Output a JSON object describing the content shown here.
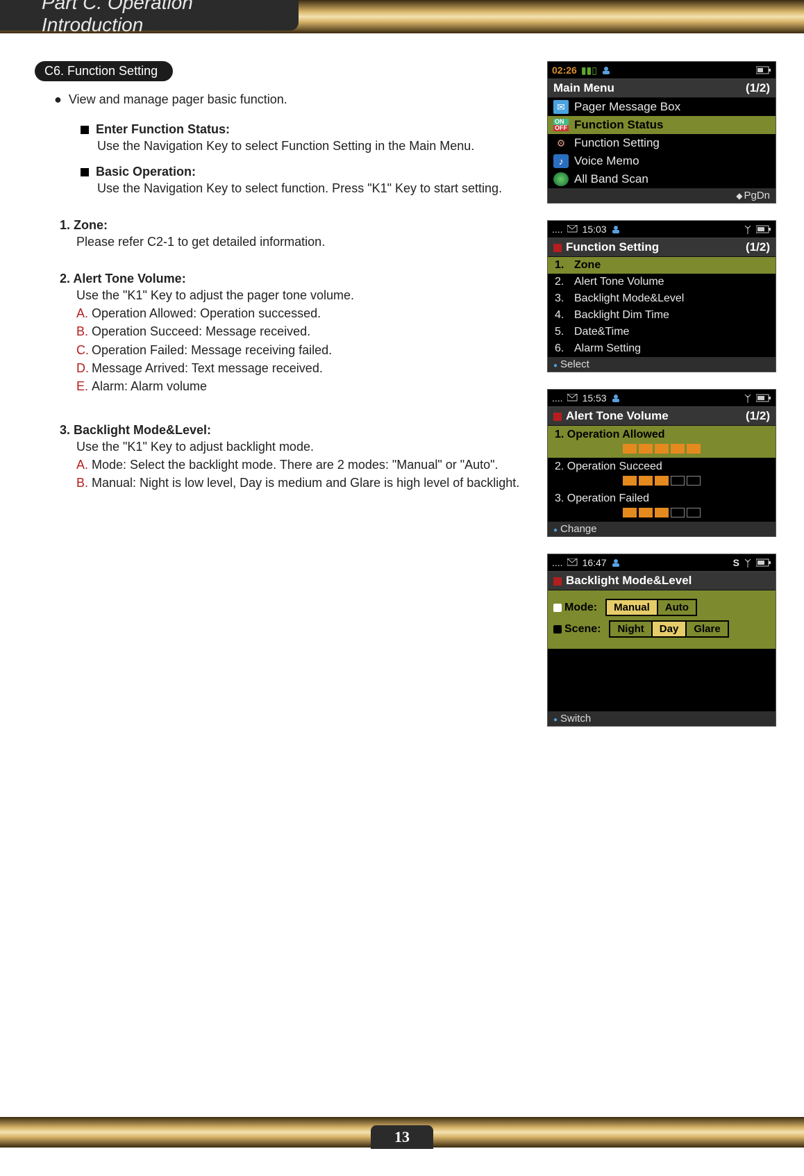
{
  "header": {
    "title": "Part C. Operation Introduction"
  },
  "section_tag": "C6. Function Setting",
  "intro_bullet": "View and manage pager basic function.",
  "squares": [
    {
      "label": "Enter Function Status:",
      "desc": "Use the Navigation Key to select Function Setting in the Main Menu."
    },
    {
      "label": "Basic Operation:",
      "desc": "Use the Navigation Key to select function. Press \"K1\" Key to start setting."
    }
  ],
  "items": {
    "item1": {
      "heading": "1. Zone:",
      "body": "Please refer C2-1 to get detailed information."
    },
    "item2": {
      "heading": "2. Alert Tone Volume:",
      "intro": "Use the \"K1\" Key to adjust the pager tone volume.",
      "subs": [
        {
          "l": "A.",
          "t": "Operation Allowed: Operation successed."
        },
        {
          "l": "B.",
          "t": "Operation Succeed: Message received."
        },
        {
          "l": "C.",
          "t": "Operation Failed: Message receiving failed."
        },
        {
          "l": "D.",
          "t": "Message Arrived: Text message received."
        },
        {
          "l": "E.",
          "t": "Alarm: Alarm volume"
        }
      ]
    },
    "item3": {
      "heading": "3. Backlight Mode&Level:",
      "intro": "Use the \"K1\" Key to adjust backlight mode.",
      "subs": [
        {
          "l": "A.",
          "t": "Mode: Select the backlight mode. There are 2 modes: \"Manual\" or \"Auto\"."
        },
        {
          "l": "B.",
          "t": "Manual: Night is low level, Day is medium and Glare is high level of backlight."
        }
      ]
    }
  },
  "page_number": "13",
  "screens": {
    "main_menu": {
      "time": "02:26",
      "title": "Main Menu",
      "page": "(1/2)",
      "rows": [
        {
          "text": "Pager Message Box"
        },
        {
          "text": "Function Status",
          "sel": true
        },
        {
          "text": "Function Setting"
        },
        {
          "text": "Voice Memo"
        },
        {
          "text": "All Band Scan"
        }
      ],
      "foot_right": "PgDn"
    },
    "function_setting": {
      "time": "15:03",
      "title": "Function Setting",
      "page": "(1/2)",
      "rows": [
        {
          "n": "1.",
          "t": "Zone",
          "sel": true
        },
        {
          "n": "2.",
          "t": "Alert Tone Volume"
        },
        {
          "n": "3.",
          "t": "Backlight Mode&Level"
        },
        {
          "n": "4.",
          "t": "Backlight Dim Time"
        },
        {
          "n": "5.",
          "t": "Date&Time"
        },
        {
          "n": "6.",
          "t": "Alarm Setting"
        }
      ],
      "foot_left": "Select"
    },
    "alert_tone": {
      "time": "15:53",
      "title": "Alert Tone Volume",
      "page": "(1/2)",
      "rows": [
        {
          "t": "1. Operation Allowed",
          "fill": 5,
          "sel": true
        },
        {
          "t": "2. Operation Succeed",
          "fill": 3
        },
        {
          "t": "3. Operation Failed",
          "fill": 3
        }
      ],
      "foot_left": "Change"
    },
    "backlight": {
      "time": "16:47",
      "status_s": "S",
      "title": "Backlight Mode&Level",
      "mode_label": "Mode:",
      "mode_opts": [
        "Manual",
        "Auto"
      ],
      "mode_active": 0,
      "scene_label": "Scene:",
      "scene_opts": [
        "Night",
        "Day",
        "Glare"
      ],
      "scene_active": 1,
      "foot_left": "Switch"
    }
  }
}
